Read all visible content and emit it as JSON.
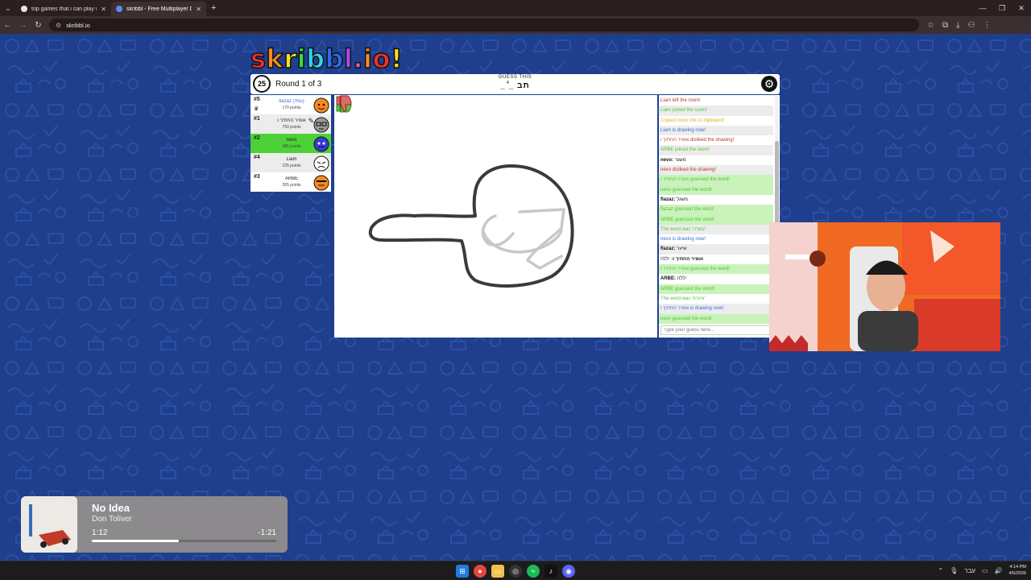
{
  "browser": {
    "tabs": [
      {
        "title": "top games that i can play with",
        "active": false
      },
      {
        "title": "skribbl - Free Multiplayer Draw",
        "active": true
      }
    ],
    "new_tab": "+",
    "url": "skribbl.io"
  },
  "logo": [
    "s",
    "k",
    "r",
    "i",
    "b",
    "b",
    "l",
    ".",
    "i",
    "o",
    "!"
  ],
  "game": {
    "timer": "25",
    "round": "Round 1 of 3",
    "guess_label": "GUESS THIS",
    "word_hint": "_ _ תב",
    "word_length": "4"
  },
  "players": [
    {
      "rank": "#5",
      "name": "flazaz (You)",
      "points": "170 points",
      "you": true,
      "drawing": false,
      "avatar_color": "#f58a1f"
    },
    {
      "rank": "#1",
      "name": "אופיר החתיך ו",
      "points": "750 points",
      "you": false,
      "drawing": false,
      "avatar_color": "#9a9a9a"
    },
    {
      "rank": "#2",
      "name": "nevo",
      "points": "385 points",
      "you": false,
      "drawing": true,
      "avatar_color": "#3b3bd6"
    },
    {
      "rank": "#4",
      "name": "Liam",
      "points": "225 points",
      "you": false,
      "drawing": false,
      "avatar_color": "#ffffff"
    },
    {
      "rank": "#3",
      "name": "ARBE",
      "points": "265 points",
      "you": false,
      "drawing": false,
      "avatar_color": "#f58a1f"
    }
  ],
  "chat": {
    "messages": [
      {
        "author": "",
        "text": "Liam left the room!",
        "color": "red",
        "highlight": false
      },
      {
        "author": "",
        "text": "Liam joined the room!",
        "color": "green",
        "highlight": false
      },
      {
        "author": "",
        "text": "Copied room link to clipboard!",
        "color": "yellow",
        "highlight": false
      },
      {
        "author": "",
        "text": "Liam is drawing now!",
        "color": "blue",
        "highlight": false
      },
      {
        "author": "",
        "text": "אופיר החתיך ו disliked the drawing!",
        "color": "red",
        "highlight": false
      },
      {
        "author": "",
        "text": "ARBE joined the room!",
        "color": "green",
        "highlight": false
      },
      {
        "author": "nevo:",
        "text": "משגר",
        "color": "dark",
        "highlight": false
      },
      {
        "author": "",
        "text": "nevo disliked the drawing!",
        "color": "red",
        "highlight": false
      },
      {
        "author": "",
        "text": "אופיר החתיך ו guessed the word!",
        "color": "green",
        "highlight": true
      },
      {
        "author": "",
        "text": "nevo guessed the word!",
        "color": "green",
        "highlight": true
      },
      {
        "author": "flazaz:",
        "text": "משגל",
        "color": "dark",
        "highlight": false
      },
      {
        "author": "",
        "text": "flazaz guessed the word!",
        "color": "green",
        "highlight": true
      },
      {
        "author": "",
        "text": "ARBE guessed the word!",
        "color": "green",
        "highlight": true
      },
      {
        "author": "",
        "text": "The word was 'קשרה'",
        "color": "green",
        "highlight": false
      },
      {
        "author": "",
        "text": "nevo is drawing now!",
        "color": "blue",
        "highlight": false
      },
      {
        "author": "flazaz:",
        "text": "שיער",
        "color": "dark",
        "highlight": false
      },
      {
        "author": "אופיר החתיך ו:",
        "text": "יללה",
        "color": "dark",
        "highlight": false
      },
      {
        "author": "",
        "text": "אופיר החתיך ו guessed the word!",
        "color": "green",
        "highlight": true
      },
      {
        "author": "ARBE:",
        "text": "יללה",
        "color": "dark",
        "highlight": false
      },
      {
        "author": "",
        "text": "ARBE guessed the word!",
        "color": "green",
        "highlight": true
      },
      {
        "author": "",
        "text": "The word was 'איטיפ'",
        "color": "green",
        "highlight": false
      },
      {
        "author": "",
        "text": "אופיר החתיך ו is drawing now!",
        "color": "blue",
        "highlight": false
      },
      {
        "author": "",
        "text": "nevo guessed the word!",
        "color": "green",
        "highlight": true
      }
    ],
    "input_placeholder": "Type your guess here..."
  },
  "media": {
    "title": "No Idea",
    "artist": "Don Toliver",
    "elapsed": "1:12",
    "remaining": "-1:21",
    "progress": 0.47
  },
  "taskbar": {
    "lang": "עבר",
    "time": "4:14 PM",
    "date": "4/5/2026"
  }
}
